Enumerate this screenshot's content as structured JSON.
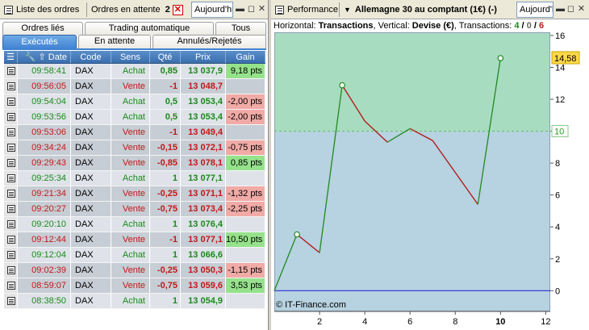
{
  "left_toolbar": {
    "orders_list_label": "Liste des ordres",
    "pending_label": "Ordres en attente",
    "pending_count": "2",
    "period_value": "Aujourd'hui",
    "pin_icon": "pin-icon",
    "restore_icon": "restore-icon",
    "close_icon": "close-icon"
  },
  "tabs": {
    "row1": [
      "Ordres liés",
      "Trading automatique",
      "Tous"
    ],
    "row2": [
      "Exécutés",
      "En attente",
      "Annulés/Rejetés"
    ],
    "active": "Exécutés"
  },
  "grid": {
    "headers": [
      "Date",
      "Code",
      "Sens",
      "Qté",
      "Prix",
      "Gain"
    ],
    "rows": [
      {
        "date": "09:58:41",
        "code": "DAX",
        "sens": "Achat",
        "qte": "0,85",
        "prix": "13 037,9",
        "gain": "9,18 pts",
        "gain_type": "pos"
      },
      {
        "date": "09:56:05",
        "code": "DAX",
        "sens": "Vente",
        "qte": "-1",
        "prix": "13 048,7",
        "gain": "",
        "gain_type": ""
      },
      {
        "date": "09:54:04",
        "code": "DAX",
        "sens": "Achat",
        "qte": "0,5",
        "prix": "13 053,4",
        "gain": "-2,00 pts",
        "gain_type": "neg"
      },
      {
        "date": "09:53:56",
        "code": "DAX",
        "sens": "Achat",
        "qte": "0,5",
        "prix": "13 053,4",
        "gain": "-2,00 pts",
        "gain_type": "neg"
      },
      {
        "date": "09:53:06",
        "code": "DAX",
        "sens": "Vente",
        "qte": "-1",
        "prix": "13 049,4",
        "gain": "",
        "gain_type": ""
      },
      {
        "date": "09:34:24",
        "code": "DAX",
        "sens": "Vente",
        "qte": "-0,15",
        "prix": "13 072,1",
        "gain": "-0,75 pts",
        "gain_type": "neg"
      },
      {
        "date": "09:29:43",
        "code": "DAX",
        "sens": "Vente",
        "qte": "-0,85",
        "prix": "13 078,1",
        "gain": "0,85 pts",
        "gain_type": "pos"
      },
      {
        "date": "09:25:34",
        "code": "DAX",
        "sens": "Achat",
        "qte": "1",
        "prix": "13 077,1",
        "gain": "",
        "gain_type": ""
      },
      {
        "date": "09:21:34",
        "code": "DAX",
        "sens": "Vente",
        "qte": "-0,25",
        "prix": "13 071,1",
        "gain": "-1,32 pts",
        "gain_type": "neg"
      },
      {
        "date": "09:20:27",
        "code": "DAX",
        "sens": "Vente",
        "qte": "-0,75",
        "prix": "13 073,4",
        "gain": "-2,25 pts",
        "gain_type": "neg"
      },
      {
        "date": "09:20:10",
        "code": "DAX",
        "sens": "Achat",
        "qte": "1",
        "prix": "13 076,4",
        "gain": "",
        "gain_type": ""
      },
      {
        "date": "09:12:44",
        "code": "DAX",
        "sens": "Vente",
        "qte": "-1",
        "prix": "13 077,1",
        "gain": "10,50 pts",
        "gain_type": "pos"
      },
      {
        "date": "09:12:04",
        "code": "DAX",
        "sens": "Achat",
        "qte": "1",
        "prix": "13 066,6",
        "gain": "",
        "gain_type": ""
      },
      {
        "date": "09:02:39",
        "code": "DAX",
        "sens": "Vente",
        "qte": "-0,25",
        "prix": "13 050,3",
        "gain": "-1,15 pts",
        "gain_type": "neg"
      },
      {
        "date": "08:59:07",
        "code": "DAX",
        "sens": "Vente",
        "qte": "-0,75",
        "prix": "13 059,6",
        "gain": "3,53 pts",
        "gain_type": "pos"
      },
      {
        "date": "08:38:50",
        "code": "DAX",
        "sens": "Achat",
        "qte": "1",
        "prix": "13 054,9",
        "gain": "",
        "gain_type": ""
      }
    ]
  },
  "right_toolbar": {
    "performance_label": "Performance",
    "instrument_label": "Allemagne 30 au comptant (1€) (-)",
    "period_value": "Aujourd'hui"
  },
  "chart_header": {
    "prefix_h": "Horizontal: ",
    "h_value": "Transactions",
    "prefix_v": ", Vertical: ",
    "v_value": "Devise (€)",
    "prefix_t": ", Transactions: ",
    "t_green": "4",
    "t_sep1": " / ",
    "t_gray": "0",
    "t_sep2": " / ",
    "t_red": "6"
  },
  "chart_data": {
    "type": "line",
    "x": [
      0,
      1,
      2,
      3,
      4,
      5,
      6,
      7,
      8,
      9,
      10
    ],
    "values": [
      0,
      3.53,
      2.38,
      12.88,
      10.63,
      9.31,
      10.16,
      9.41,
      7.41,
      5.41,
      14.58
    ],
    "x_ticks": [
      "2",
      "4",
      "6",
      "8",
      "10",
      "12"
    ],
    "y_ticks": [
      "0",
      "2",
      "4",
      "6",
      "8",
      "10",
      "12",
      "14",
      "16"
    ],
    "xlim": [
      0,
      12.2
    ],
    "ylim": [
      -1.3,
      16.2
    ],
    "reference_line": 10,
    "reference_label": "10",
    "last_value_label": "14,58",
    "zero_label": "0",
    "credit": "© IT-Finance.com",
    "colors": {
      "up": "#1f8a1f",
      "down": "#b01515",
      "above_band": "#a8dcc0",
      "below_band": "#b7d2e0",
      "zero_line": "#1a1ad0",
      "marker": "#ffffff",
      "highlight": "#ffd84a"
    }
  }
}
